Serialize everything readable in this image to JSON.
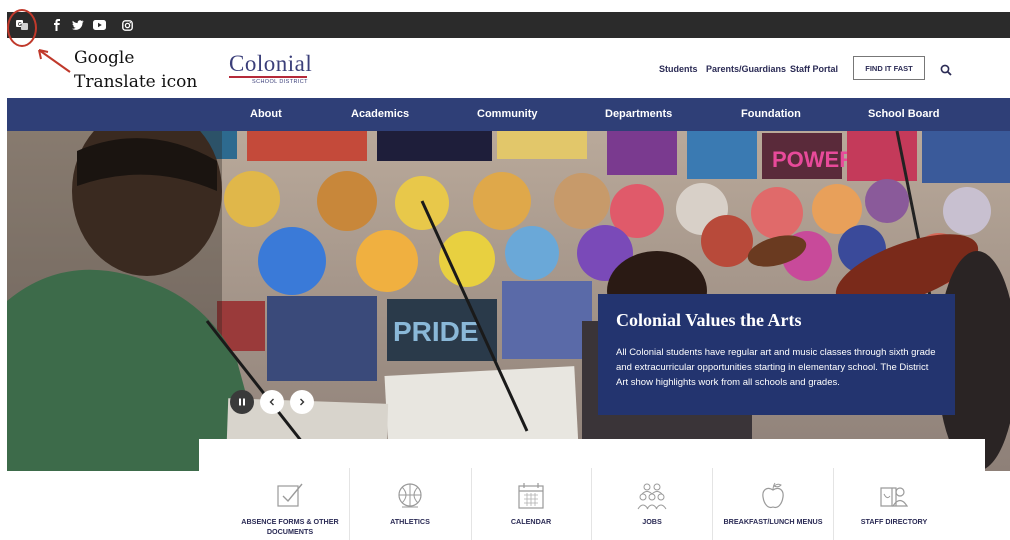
{
  "annotation": {
    "label_line1": "Google",
    "label_line2": "Translate icon",
    "color": "#c0392b"
  },
  "topbar": {
    "icons": [
      "google-translate-icon",
      "facebook-icon",
      "twitter-icon",
      "youtube-icon",
      "instagram-icon"
    ]
  },
  "header": {
    "logo_text": "Colonial",
    "logo_subtext": "SCHOOL DISTRICT",
    "utility_links": [
      "Students",
      "Parents/Guardians",
      "Staff Portal"
    ],
    "find_button": "FIND IT FAST"
  },
  "nav": {
    "items": [
      "About",
      "Academics",
      "Community",
      "Departments",
      "Foundation",
      "School Board"
    ],
    "background": "#2f3f77"
  },
  "hero": {
    "signs": [
      "POWER",
      "PRIDE"
    ],
    "caption_title": "Colonial Values the Arts",
    "caption_body": "All Colonial students have regular art and music classes through sixth grade and extracurricular opportunities starting in elementary school. The District Art show highlights work from all schools and grades.",
    "caption_bg": "#23346f"
  },
  "quick_links": [
    {
      "label_line1": "ABSENCE FORMS & OTHER",
      "label_line2": "DOCUMENTS",
      "icon": "checkbox-icon"
    },
    {
      "label_line1": "ATHLETICS",
      "label_line2": "",
      "icon": "ball-icon"
    },
    {
      "label_line1": "CALENDAR",
      "label_line2": "",
      "icon": "calendar-icon"
    },
    {
      "label_line1": "JOBS",
      "label_line2": "",
      "icon": "people-icon"
    },
    {
      "label_line1": "BREAKFAST/LUNCH MENUS",
      "label_line2": "",
      "icon": "apple-icon"
    },
    {
      "label_line1": "STAFF DIRECTORY",
      "label_line2": "",
      "icon": "directory-icon"
    }
  ]
}
